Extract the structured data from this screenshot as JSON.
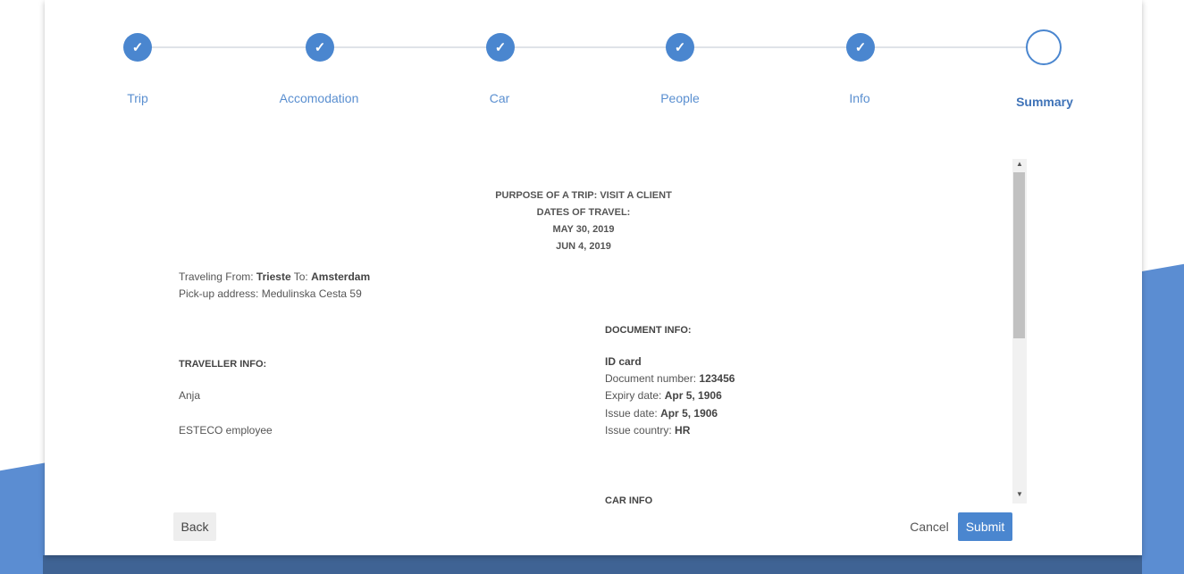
{
  "stepper": {
    "steps": [
      {
        "label": "Trip",
        "done": true,
        "check": "✓"
      },
      {
        "label": "Accomodation",
        "done": true,
        "check": "✓"
      },
      {
        "label": "Car",
        "done": true,
        "check": "✓"
      },
      {
        "label": "People",
        "done": true,
        "check": "✓"
      },
      {
        "label": "Info",
        "done": true,
        "check": "✓"
      },
      {
        "label": "Summary",
        "done": false,
        "check": ""
      }
    ]
  },
  "summary": {
    "purpose_line": "PURPOSE OF A TRIP: VISIT A CLIENT",
    "dates_heading": "DATES OF TRAVEL:",
    "date_from": "MAY 30, 2019",
    "date_to": "JUN 4, 2019",
    "traveling_from_label": "Traveling From:",
    "traveling_from_value": "Trieste",
    "traveling_to_label": "To:",
    "traveling_to_value": "Amsterdam",
    "pickup_line": "Pick-up address: Medulinska Cesta 59",
    "traveller_heading": "TRAVELLER INFO:",
    "traveller_name": "Anja",
    "traveller_role": "ESTECO employee",
    "document_heading": "DOCUMENT INFO:",
    "document_type": "ID card",
    "doc_number_label": "Document number:",
    "doc_number_value": "123456",
    "expiry_label": "Expiry date:",
    "expiry_value": "Apr 5, 1906",
    "issue_label": "Issue date:",
    "issue_value": "Apr 5, 1906",
    "country_label": "Issue country:",
    "country_value": "HR",
    "car_heading": "CAR INFO"
  },
  "scrollbar": {
    "up": "▲",
    "down": "▼"
  },
  "buttons": {
    "back": "Back",
    "cancel": "Cancel",
    "submit": "Submit"
  },
  "colors": {
    "accent": "#4a86cf",
    "background_blue": "#5b8dd2",
    "background_dark": "#3f6394"
  }
}
